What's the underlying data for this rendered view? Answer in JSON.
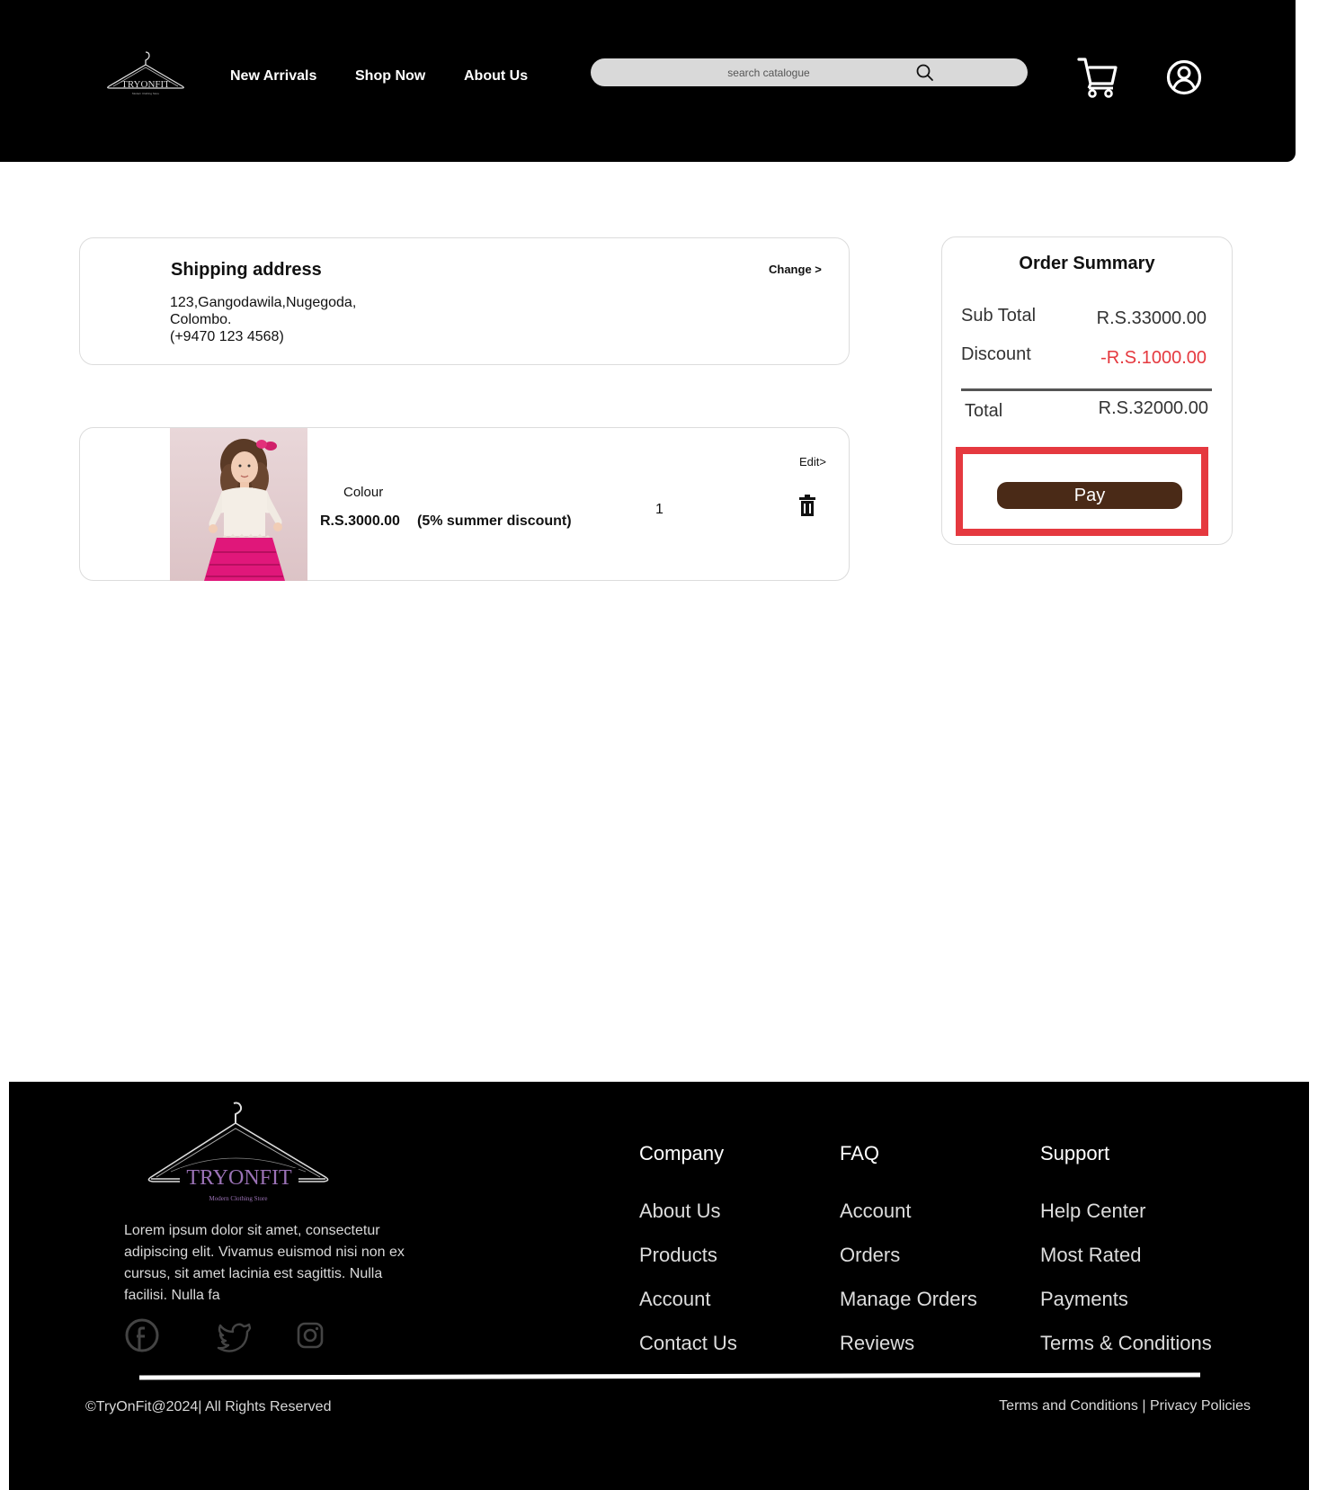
{
  "header": {
    "nav": [
      {
        "label": "New Arrivals"
      },
      {
        "label": "Shop Now"
      },
      {
        "label": "About Us"
      }
    ],
    "search": {
      "placeholder": "search catalogue"
    }
  },
  "shipping": {
    "title": "Shipping address",
    "change_label": "Change >",
    "address_line1": "123,Gangodawila,Nugegoda,",
    "address_line2": "Colombo.",
    "phone": "(+9470 123 4568)"
  },
  "cart_item": {
    "colour_label": "Colour",
    "price": "R.S.3000.00",
    "discount_note": "(5% summer discount)",
    "quantity": "1",
    "edit_label": "Edit>"
  },
  "summary": {
    "title": "Order Summary",
    "subtotal_label": "Sub Total",
    "subtotal_value": "R.S.33000.00",
    "discount_label": "Discount",
    "discount_value": "-R.S.1000.00",
    "total_label": "Total",
    "total_value": "R.S.32000.00",
    "pay_label": "Pay",
    "discount_color": "#e5393f",
    "pay_color": "#4a2a17",
    "highlight_color": "#e5393f"
  },
  "footer": {
    "description": "Lorem ipsum dolor sit amet, consectetur adipiscing elit. Vivamus euismod nisi non ex cursus, sit amet lacinia est sagittis. Nulla facilisi. Nulla fa",
    "columns": [
      {
        "title": "Company",
        "links": [
          "About Us",
          "Products",
          "Account",
          "Contact Us"
        ]
      },
      {
        "title": "FAQ",
        "links": [
          "Account",
          "Orders",
          "Manage Orders",
          "Reviews"
        ]
      },
      {
        "title": "Support",
        "links": [
          "Help Center",
          "Most Rated",
          "Payments",
          "Terms & Conditions"
        ]
      }
    ],
    "social_icons": [
      "facebook-icon",
      "twitter-icon",
      "instagram-icon"
    ],
    "copyright": "©TryOnFit@2024| All Rights Reserved",
    "legal_terms": "Terms and Conditions",
    "legal_separator": " | ",
    "legal_privacy": "Privacy Policies"
  },
  "brand": {
    "name": "TRYONFIT",
    "tagline": "Modern Clothing Store"
  }
}
